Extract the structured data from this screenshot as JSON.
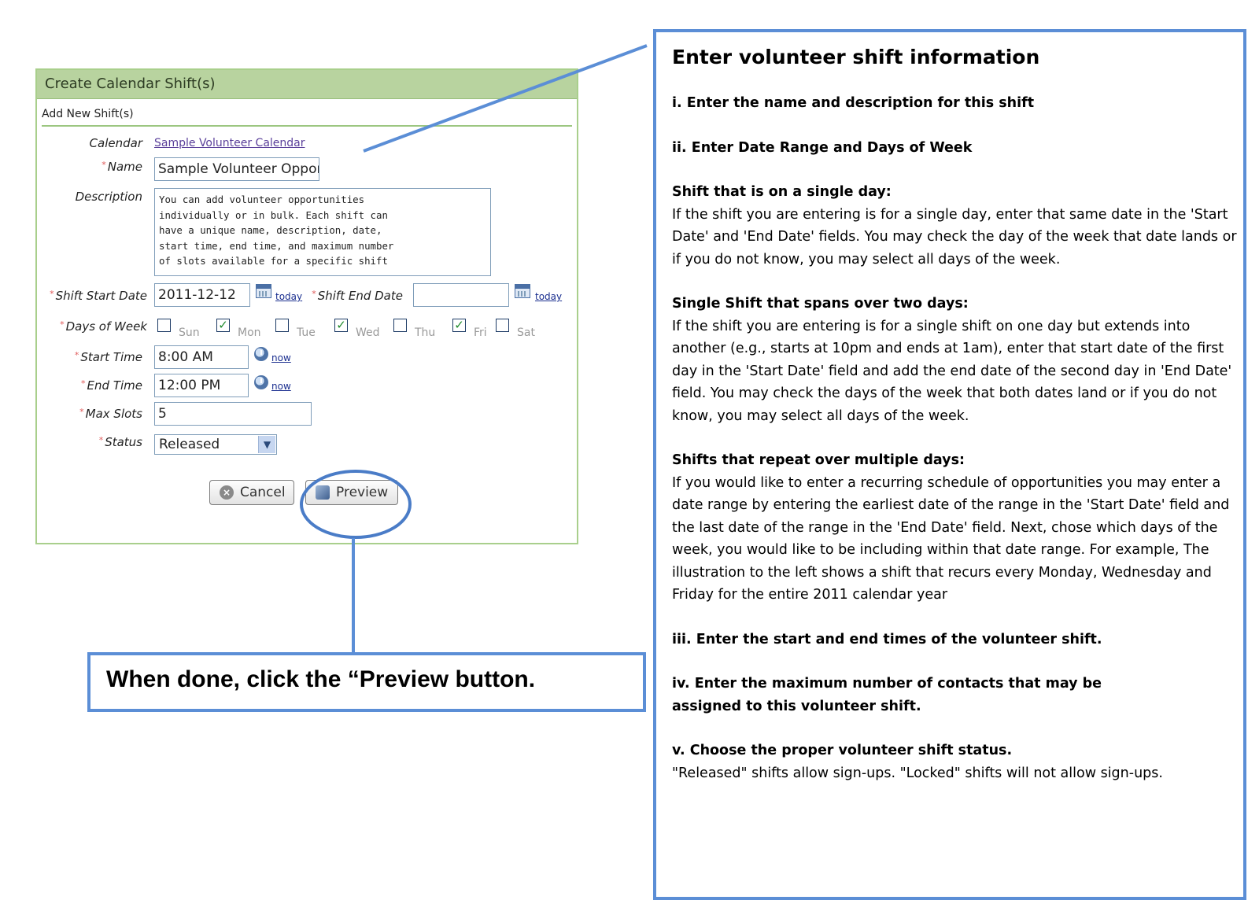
{
  "form": {
    "title": "Create Calendar Shift(s)",
    "subheader": "Add New Shift(s)",
    "required_mark": "*",
    "calendar": {
      "label": "Calendar",
      "value": "Sample Volunteer Calendar"
    },
    "name": {
      "label": "Name",
      "value": "Sample Volunteer Oppor"
    },
    "description": {
      "label": "Description",
      "value": "You can add volunteer opportunities\nindividually or in bulk. Each shift can\nhave a unique name, description, date,\nstart time, end time, and maximum number\nof slots available for a specific shift"
    },
    "shift_start_date": {
      "label": "Shift Start Date",
      "value": "2011-12-12",
      "today_link": "today"
    },
    "shift_end_date": {
      "label": "Shift End Date",
      "value": "",
      "today_link": "today"
    },
    "days_of_week": {
      "label": "Days of Week",
      "days": [
        {
          "label": "Sun",
          "checked": false
        },
        {
          "label": "Mon",
          "checked": true
        },
        {
          "label": "Tue",
          "checked": false
        },
        {
          "label": "Wed",
          "checked": true
        },
        {
          "label": "Thu",
          "checked": false
        },
        {
          "label": "Fri",
          "checked": true
        },
        {
          "label": "Sat",
          "checked": false
        }
      ]
    },
    "start_time": {
      "label": "Start Time",
      "value": "8:00 AM",
      "now_link": "now"
    },
    "end_time": {
      "label": "End Time",
      "value": "12:00 PM",
      "now_link": "now"
    },
    "max_slots": {
      "label": "Max Slots",
      "value": "5"
    },
    "status": {
      "label": "Status",
      "value": "Released"
    },
    "buttons": {
      "cancel": "Cancel",
      "preview": "Preview"
    },
    "checkmark": "✓"
  },
  "callout": {
    "text": "When done, click the “Preview button."
  },
  "instructions": {
    "title": "Enter volunteer shift information",
    "step1": "i.  Enter the name and description for this shift",
    "step2": "ii. Enter Date Range and Days of Week",
    "single_day_heading": "Shift that is on a single day:",
    "single_day_text": "If the shift you are entering is for a single day, enter that same date in the 'Start Date' and 'End Date' fields. You may check the day of the week that date lands or if you do not know, you may select all days of the week.",
    "two_days_heading": "Single Shift that spans over two days:",
    "two_days_text": "If the shift you are entering is for a single shift on one day but extends into another (e.g., starts at 10pm and ends at 1am), enter that start date of the first day in the 'Start Date' field and add the end date of the second day in 'End Date' field. You may check the days of the week that both dates land or if you do not know, you may select all days of the week.",
    "repeat_heading": "Shifts that repeat over multiple days:",
    "repeat_text": "If you would like to enter a recurring schedule of opportunities you may enter a date range by entering the earliest date of the range in the 'Start Date' field and the last date of the range in the 'End Date' field. Next, chose which days of the week, you would like to be including within that date range. For example, The illustration to the left shows a shift that recurs every Monday, Wednesday and Friday for the entire 2011 calendar year",
    "step3": "iii. Enter the start and end times of the volunteer shift.",
    "step4": "iv. Enter the maximum number of contacts that may be assigned to this volunteer shift.",
    "step5": "v. Choose the proper volunteer shift status.",
    "step5_text": "\"Released\" shifts allow sign-ups. \"Locked\" shifts will not allow sign-ups."
  },
  "colors": {
    "annotation_blue": "#5b8ed6",
    "panel_header": "#b8d39f",
    "panel_border": "#a9cf8c",
    "required": "#e05a5a"
  }
}
